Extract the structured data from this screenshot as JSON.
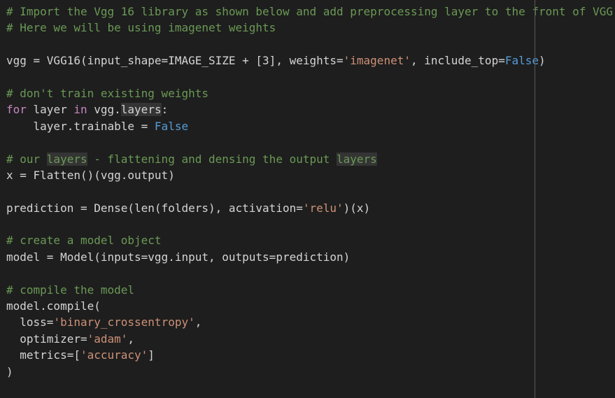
{
  "editor": {
    "colors": {
      "background": "#1e1e1e",
      "text": "#d4d4d4",
      "comment": "#6a9955",
      "keyword": "#c586c0",
      "string": "#ce9178",
      "constant": "#569cd6",
      "highlight": "#343434",
      "ruler": "#5a5a5a"
    },
    "lines": [
      [
        {
          "t": "c",
          "v": "# Import the Vgg 16 library as shown below and add preprocessing layer to the front of VGG"
        }
      ],
      [
        {
          "t": "c",
          "v": "# Here we will be using imagenet weights"
        }
      ],
      [],
      [
        {
          "t": "p",
          "v": "vgg = VGG16(input_shape=IMAGE_SIZE + [3], weights="
        },
        {
          "t": "s",
          "v": "'imagenet'"
        },
        {
          "t": "p",
          "v": ", include_top="
        },
        {
          "t": "k2",
          "v": "False"
        },
        {
          "t": "p",
          "v": ")"
        }
      ],
      [],
      [
        {
          "t": "c",
          "v": "# don't train existing weights"
        }
      ],
      [
        {
          "t": "k",
          "v": "for"
        },
        {
          "t": "p",
          "v": " layer "
        },
        {
          "t": "k",
          "v": "in"
        },
        {
          "t": "p",
          "v": " vgg."
        },
        {
          "t": "h",
          "v": "layers"
        },
        {
          "t": "p",
          "v": ":"
        }
      ],
      [
        {
          "t": "p",
          "v": "    layer.trainable = "
        },
        {
          "t": "k2",
          "v": "False"
        }
      ],
      [],
      [
        {
          "t": "c",
          "v": "# our "
        },
        {
          "t": "ch",
          "v": "layers"
        },
        {
          "t": "c",
          "v": " - flattening and densing the output "
        },
        {
          "t": "ch",
          "v": "layers"
        }
      ],
      [
        {
          "t": "p",
          "v": "x = Flatten()(vgg.output)"
        }
      ],
      [],
      [
        {
          "t": "p",
          "v": "prediction = Dense(len(folders), activation="
        },
        {
          "t": "s",
          "v": "'relu'"
        },
        {
          "t": "p",
          "v": ")(x)"
        }
      ],
      [],
      [
        {
          "t": "c",
          "v": "# create a model object"
        }
      ],
      [
        {
          "t": "p",
          "v": "model = Model(inputs=vgg.input, outputs=prediction)"
        }
      ],
      [],
      [
        {
          "t": "c",
          "v": "# compile the model"
        }
      ],
      [
        {
          "t": "p",
          "v": "model.compile("
        }
      ],
      [
        {
          "t": "p",
          "v": "  loss="
        },
        {
          "t": "s",
          "v": "'binary_crossentropy'"
        },
        {
          "t": "p",
          "v": ","
        }
      ],
      [
        {
          "t": "p",
          "v": "  optimizer="
        },
        {
          "t": "s",
          "v": "'adam'"
        },
        {
          "t": "p",
          "v": ","
        }
      ],
      [
        {
          "t": "p",
          "v": "  metrics=["
        },
        {
          "t": "s",
          "v": "'accuracy'"
        },
        {
          "t": "p",
          "v": "]"
        }
      ],
      [
        {
          "t": "p",
          "v": ")"
        }
      ]
    ]
  }
}
